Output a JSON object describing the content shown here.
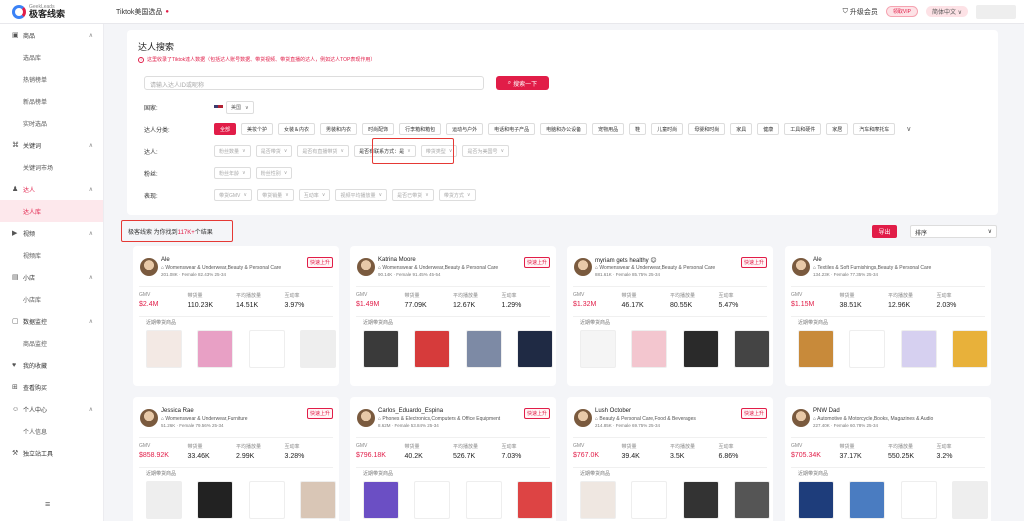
{
  "topbar": {
    "logo_en": "GeekLeads",
    "logo_cn": "极客线索",
    "page_tab": "Tiktok美国选品",
    "upgrade": "升级会员",
    "vip": "领取VIP",
    "language": "简体中文 ∨"
  },
  "sidebar": {
    "groups": [
      {
        "icon": "box-icon",
        "label": "商品",
        "subs": [
          "选品库",
          "热销榜单",
          "新品榜单",
          "实时选品"
        ]
      },
      {
        "icon": "key-icon",
        "label": "关键词",
        "subs": [
          "关键词市场"
        ]
      },
      {
        "icon": "user-icon",
        "label": "达人",
        "subs": [
          "达人库"
        ]
      },
      {
        "icon": "video-icon",
        "label": "视频",
        "subs": [
          "视频库"
        ]
      },
      {
        "icon": "store-icon",
        "label": "小店",
        "subs": [
          "小店库"
        ]
      },
      {
        "icon": "monitor-icon",
        "label": "数据监控",
        "subs": [
          "商品监控"
        ]
      },
      {
        "icon": "favorite-icon",
        "label": "我的收藏",
        "subs": []
      },
      {
        "icon": "cart-icon",
        "label": "查看购买",
        "subs": []
      },
      {
        "icon": "person-icon",
        "label": "个人中心",
        "subs": [
          "个人信息"
        ]
      },
      {
        "icon": "tool-icon",
        "label": "独立站工具",
        "subs": []
      }
    ]
  },
  "panel": {
    "title": "达人搜索",
    "note": "这里收录了Tiktok達人数据（包括达人账号数据、带货视频、带货直播的达人，例如达人TOP表现作用）",
    "search_placeholder": "请输入达人ID或昵称",
    "search_button": "搜索一下",
    "country_label": "国家:",
    "country_value": "美国",
    "category_label": "达人分类:",
    "categories": [
      "全部",
      "美妆个护",
      "女装＆内衣",
      "男装和内衣",
      "时尚配饰",
      "行李箱和箱包",
      "运动与户外",
      "电话和电子产品",
      "电脑和办公设备",
      "宠物用品",
      "鞋",
      "儿童时尚",
      "母婴和时尚",
      "家具",
      "健康",
      "工具和硬件",
      "家居",
      "汽车和摩托车"
    ],
    "influencer_label": "达人:",
    "influencer_filters": [
      "粉丝数量",
      "是否带货",
      "是否有直播带货",
      "是否有联系方式：是",
      "带货类型",
      "是否为美国号"
    ],
    "fans_label": "粉丝:",
    "fans_filters": [
      "粉丝年龄",
      "粉丝性别"
    ],
    "perf_label": "表现:",
    "perf_filters": [
      "带货GMV",
      "带货销量",
      "互动率",
      "视频平均播放量",
      "是否已带货",
      "带货方式"
    ]
  },
  "results": {
    "prefix": "极客线索 为你找到",
    "count": "117K+",
    "suffix": "个结果",
    "export": "导出",
    "sort": "排序"
  },
  "metric_labels": [
    "GMV",
    "带货量",
    "平均播放量",
    "互动率"
  ],
  "products_label": "近期带货商品",
  "cards": [
    {
      "name": "Ale",
      "cat": "Womenswear & Underwear,Beauty & Personal Care",
      "fol": "201.08K · Female 82.43% 25-34",
      "tag": "快速上升",
      "gmv": "$2.4M",
      "sales": "110.23K",
      "views": "14.51K",
      "rate": "3.97%"
    },
    {
      "name": "Katrina Moore",
      "cat": "Womenswear & Underwear,Beauty & Personal Care",
      "fol": "90.14K · Female 91.45% 45-54",
      "tag": "快速上升",
      "gmv": "$1.49M",
      "sales": "77.09K",
      "views": "12.67K",
      "rate": "1.29%"
    },
    {
      "name": "myriam gets healthy 😊",
      "cat": "Womenswear & Underwear,Beauty & Personal Care",
      "fol": "881.61K · Female 85.75% 25-34",
      "tag": "快速上升",
      "gmv": "$1.32M",
      "sales": "46.17K",
      "views": "80.55K",
      "rate": "5.47%"
    },
    {
      "name": "Ale",
      "cat": "Textiles & Soft Furnishings,Beauty & Personal Care",
      "fol": "134.23K · Female 77.35% 25-34",
      "tag": "",
      "gmv": "$1.15M",
      "sales": "38.51K",
      "views": "12.96K",
      "rate": "2.03%"
    },
    {
      "name": "Jessica Rae",
      "cat": "Womenswear & Underwear,Furniture",
      "fol": "51.26K · Female 79.56% 25-34",
      "tag": "快速上升",
      "gmv": "$858.92K",
      "sales": "33.46K",
      "views": "2.99K",
      "rate": "3.28%"
    },
    {
      "name": "Carlos_Eduardo_Espina",
      "cat": "Phones & Electronics,Computers & Office Equipment",
      "fol": "8.62M · Female 53.84% 25-34",
      "tag": "快速上升",
      "gmv": "$796.18K",
      "sales": "40.2K",
      "views": "526.7K",
      "rate": "7.03%"
    },
    {
      "name": "Lush October",
      "cat": "Beauty & Personal Care,Food & Beverages",
      "fol": "214.85K · Female 69.75% 25-34",
      "tag": "快速上升",
      "gmv": "$767.0K",
      "sales": "39.4K",
      "views": "3.5K",
      "rate": "6.86%"
    },
    {
      "name": "PNW Dad",
      "cat": "Automotive & Motorcycle,Books, Magazines & Audio",
      "fol": "227.40K · Female 60.78% 25-34",
      "tag": "",
      "gmv": "$705.34K",
      "sales": "37.17K",
      "views": "550.25K",
      "rate": "3.2%"
    }
  ],
  "colors": {
    "accent": "#e11d48",
    "highlight_box": "#e53935"
  }
}
